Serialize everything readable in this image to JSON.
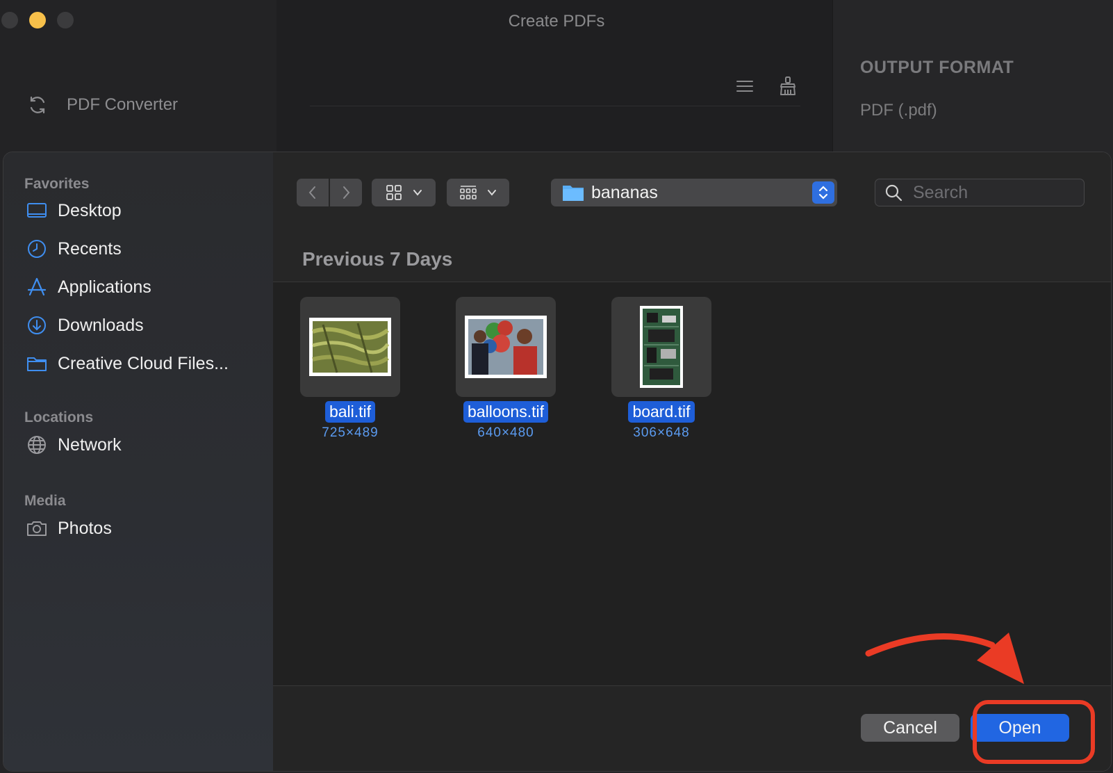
{
  "app": {
    "window_title": "Create PDFs",
    "sidebar_item": "PDF Converter",
    "output_heading": "OUTPUT FORMAT",
    "output_value": "PDF (.pdf)"
  },
  "dialog": {
    "sidebar": {
      "sections": [
        {
          "heading": "Favorites",
          "items": [
            {
              "label": "Desktop",
              "icon": "desktop-icon"
            },
            {
              "label": "Recents",
              "icon": "clock-icon"
            },
            {
              "label": "Applications",
              "icon": "applications-icon"
            },
            {
              "label": "Downloads",
              "icon": "download-icon"
            },
            {
              "label": "Creative Cloud Files...",
              "icon": "folder-icon"
            }
          ]
        },
        {
          "heading": "Locations",
          "items": [
            {
              "label": "Network",
              "icon": "globe-icon"
            }
          ]
        },
        {
          "heading": "Media",
          "items": [
            {
              "label": "Photos",
              "icon": "camera-icon"
            }
          ]
        }
      ]
    },
    "toolbar": {
      "current_folder": "bananas",
      "search_placeholder": "Search"
    },
    "group_heading": "Previous 7 Days",
    "files": [
      {
        "name": "bali.tif",
        "dims": "725×489"
      },
      {
        "name": "balloons.tif",
        "dims": "640×480"
      },
      {
        "name": "board.tif",
        "dims": "306×648"
      }
    ],
    "buttons": {
      "cancel": "Cancel",
      "open": "Open"
    }
  },
  "colors": {
    "accent": "#2166e2",
    "annotation": "#ea3b25"
  }
}
